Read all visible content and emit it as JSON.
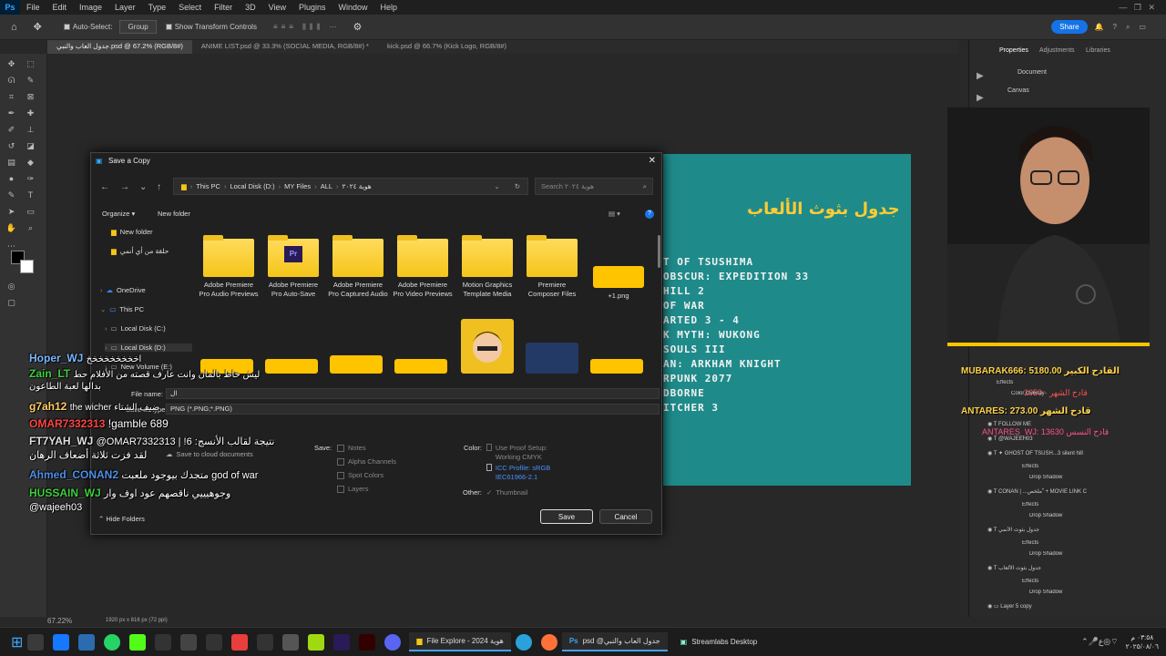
{
  "menubar": {
    "app_icon": "Ps",
    "items": [
      "File",
      "Edit",
      "Image",
      "Layer",
      "Type",
      "Select",
      "Filter",
      "3D",
      "View",
      "Plugins",
      "Window",
      "Help"
    ]
  },
  "options": {
    "auto_select": "Auto-Select:",
    "group": "Group",
    "show_transform": "Show Transform Controls",
    "share": "Share"
  },
  "doc_tabs": [
    "جدول العاب والنبي.psd @ 67.2% (RGB/8#)",
    "ANIME LIST.psd @ 33.3% (SOCIAL MEDIA, RGB/8#) *",
    "kick.psd @ 66.7% (Kick Logo, RGB/8#)"
  ],
  "document": {
    "title": "جدول بثوث الألعاب",
    "lines": [
      "T OF TSUSHIMA",
      "OBSCUR: EXPEDITION 33",
      "HILL 2",
      "OF WAR",
      "ARTED 3 - 4",
      "K MYTH: WUKONG",
      "SOULS III",
      "AN: ARKHAM KNIGHT",
      "RPUNK 2077",
      "DBORNE",
      "ITCHER 3"
    ]
  },
  "right_panel": {
    "tabs": [
      "Properties",
      "Adjustments",
      "Libraries"
    ],
    "document_label": "Document",
    "canvas_label": "Canvas"
  },
  "overlay": {
    "sub1": "MUBARAK666: 5180.00 القادح الكبير",
    "sub2": "ANTARES: 273.00 قادح الشهر",
    "sub3": "قادح الشهر - 2050",
    "sub4": "ANTARES_WJ: 13630 قادح النسس"
  },
  "layers": [
    {
      "name": "Effects"
    },
    {
      "name": "Color Overlay"
    },
    {
      "name": "FOLLOW ME"
    },
    {
      "name": "@WAJEEH03"
    },
    {
      "name": "✦ GHOST OF TSUSH...3 silent hill"
    },
    {
      "name": "Effects"
    },
    {
      "name": "Drop Shadow"
    },
    {
      "name": "CONAN | ...ملخص ّ + MOVIE LINK C"
    },
    {
      "name": "Effects"
    },
    {
      "name": "Drop Shadow"
    },
    {
      "name": "جدول بثوث الأنمي"
    },
    {
      "name": "Effects"
    },
    {
      "name": "Drop Shadow"
    },
    {
      "name": "جدول بثوث الألعاب"
    },
    {
      "name": "Effects"
    },
    {
      "name": "Drop Shadow"
    },
    {
      "name": "Layer 5 copy"
    }
  ],
  "status": {
    "zoom": "67.22%",
    "size": "1920 px x 816 px (72 ppi)"
  },
  "dialog": {
    "title": "Save a Copy",
    "breadcrumb": [
      "This PC",
      "Local Disk (D:)",
      "MY Files",
      "ALL",
      "هوية ٢٠٢٤"
    ],
    "search_placeholder": "Search هوية ٢٠٢٤",
    "organize": "Organize",
    "new_folder": "New folder",
    "nav": [
      "New folder",
      "حلقة من أي أنمي",
      "OneDrive",
      "This PC",
      "Local Disk (C:)",
      "Local Disk (D:)",
      "New Volume (E:)"
    ],
    "folders": [
      "Adobe Premiere Pro Audio Previews",
      "Adobe Premiere Pro Auto-Save",
      "Adobe Premiere Pro Captured Audio",
      "Adobe Premiere Pro Video Previews",
      "Motion Graphics Template Media",
      "Premiere Composer Files",
      "+1.png"
    ],
    "file_name_label": "File name:",
    "file_name_value": "ال",
    "save_type_label": "Save as type:",
    "save_type_value": "PNG (*.PNG;*.PNG)",
    "cloud": "Save to cloud documents",
    "save_label": "Save:",
    "save_opts": [
      "Notes",
      "Alpha Channels",
      "Spot Colors",
      "Layers"
    ],
    "color_label": "Color:",
    "proof": "Use Proof Setup: Working CMYK",
    "icc": "ICC Profile: sRGB IEC61966-2.1",
    "other_label": "Other:",
    "thumbnail": "Thumbnail",
    "hide_folders": "Hide Folders",
    "save_btn": "Save",
    "cancel_btn": "Cancel"
  },
  "chat": [
    {
      "user": "Hoper_WJ",
      "msg": "اخخخخخخخخخ",
      "color": "#7ab8ff"
    },
    {
      "user": "Zain_LT",
      "msg": "ليش حاط بالمان وانت عارف قصته من الأفلام حط بدالها لعبة الطاعون",
      "color": "#3cd13c"
    },
    {
      "user": "g7ah12",
      "msg": "the wicher ضيف الشتاء",
      "color": "#ffcc66"
    },
    {
      "user": "OMAR7332313",
      "msg": "!gamble 689",
      "color": "#ff4444"
    },
    {
      "user": "FT7YAH_WJ",
      "msg": "@OMAR7332313 نتيجة لقالب الأنسج: 6! | لقد فزت ثلاثة أضعاف الرهان",
      "color": "#e0e0e0"
    },
    {
      "user": "Ahmed_CONAN2",
      "msg": "متجدك بيوجود ملعبت god of war",
      "color": "#4f8fe8"
    },
    {
      "user": "HUSSAIN_WJ",
      "msg": "وجوهيييي ناقصهم عود اوف وار @wajeeh03",
      "color": "#3cd13c"
    }
  ],
  "taskbar": {
    "explorer": "File Explore - 2024 هوية",
    "ps_doc": "psd @جدول العاب والنبي",
    "streamlabs": "Streamlabs Desktop",
    "time": "٠٣:٥٨ م",
    "date": "٢٠٢٥/٠٨/٠٦"
  },
  "colors": {
    "ps_bg": "#282828",
    "doc_teal": "#1f8a8a",
    "accent": "#ffc400",
    "save_btn": "#2d2d2d"
  }
}
